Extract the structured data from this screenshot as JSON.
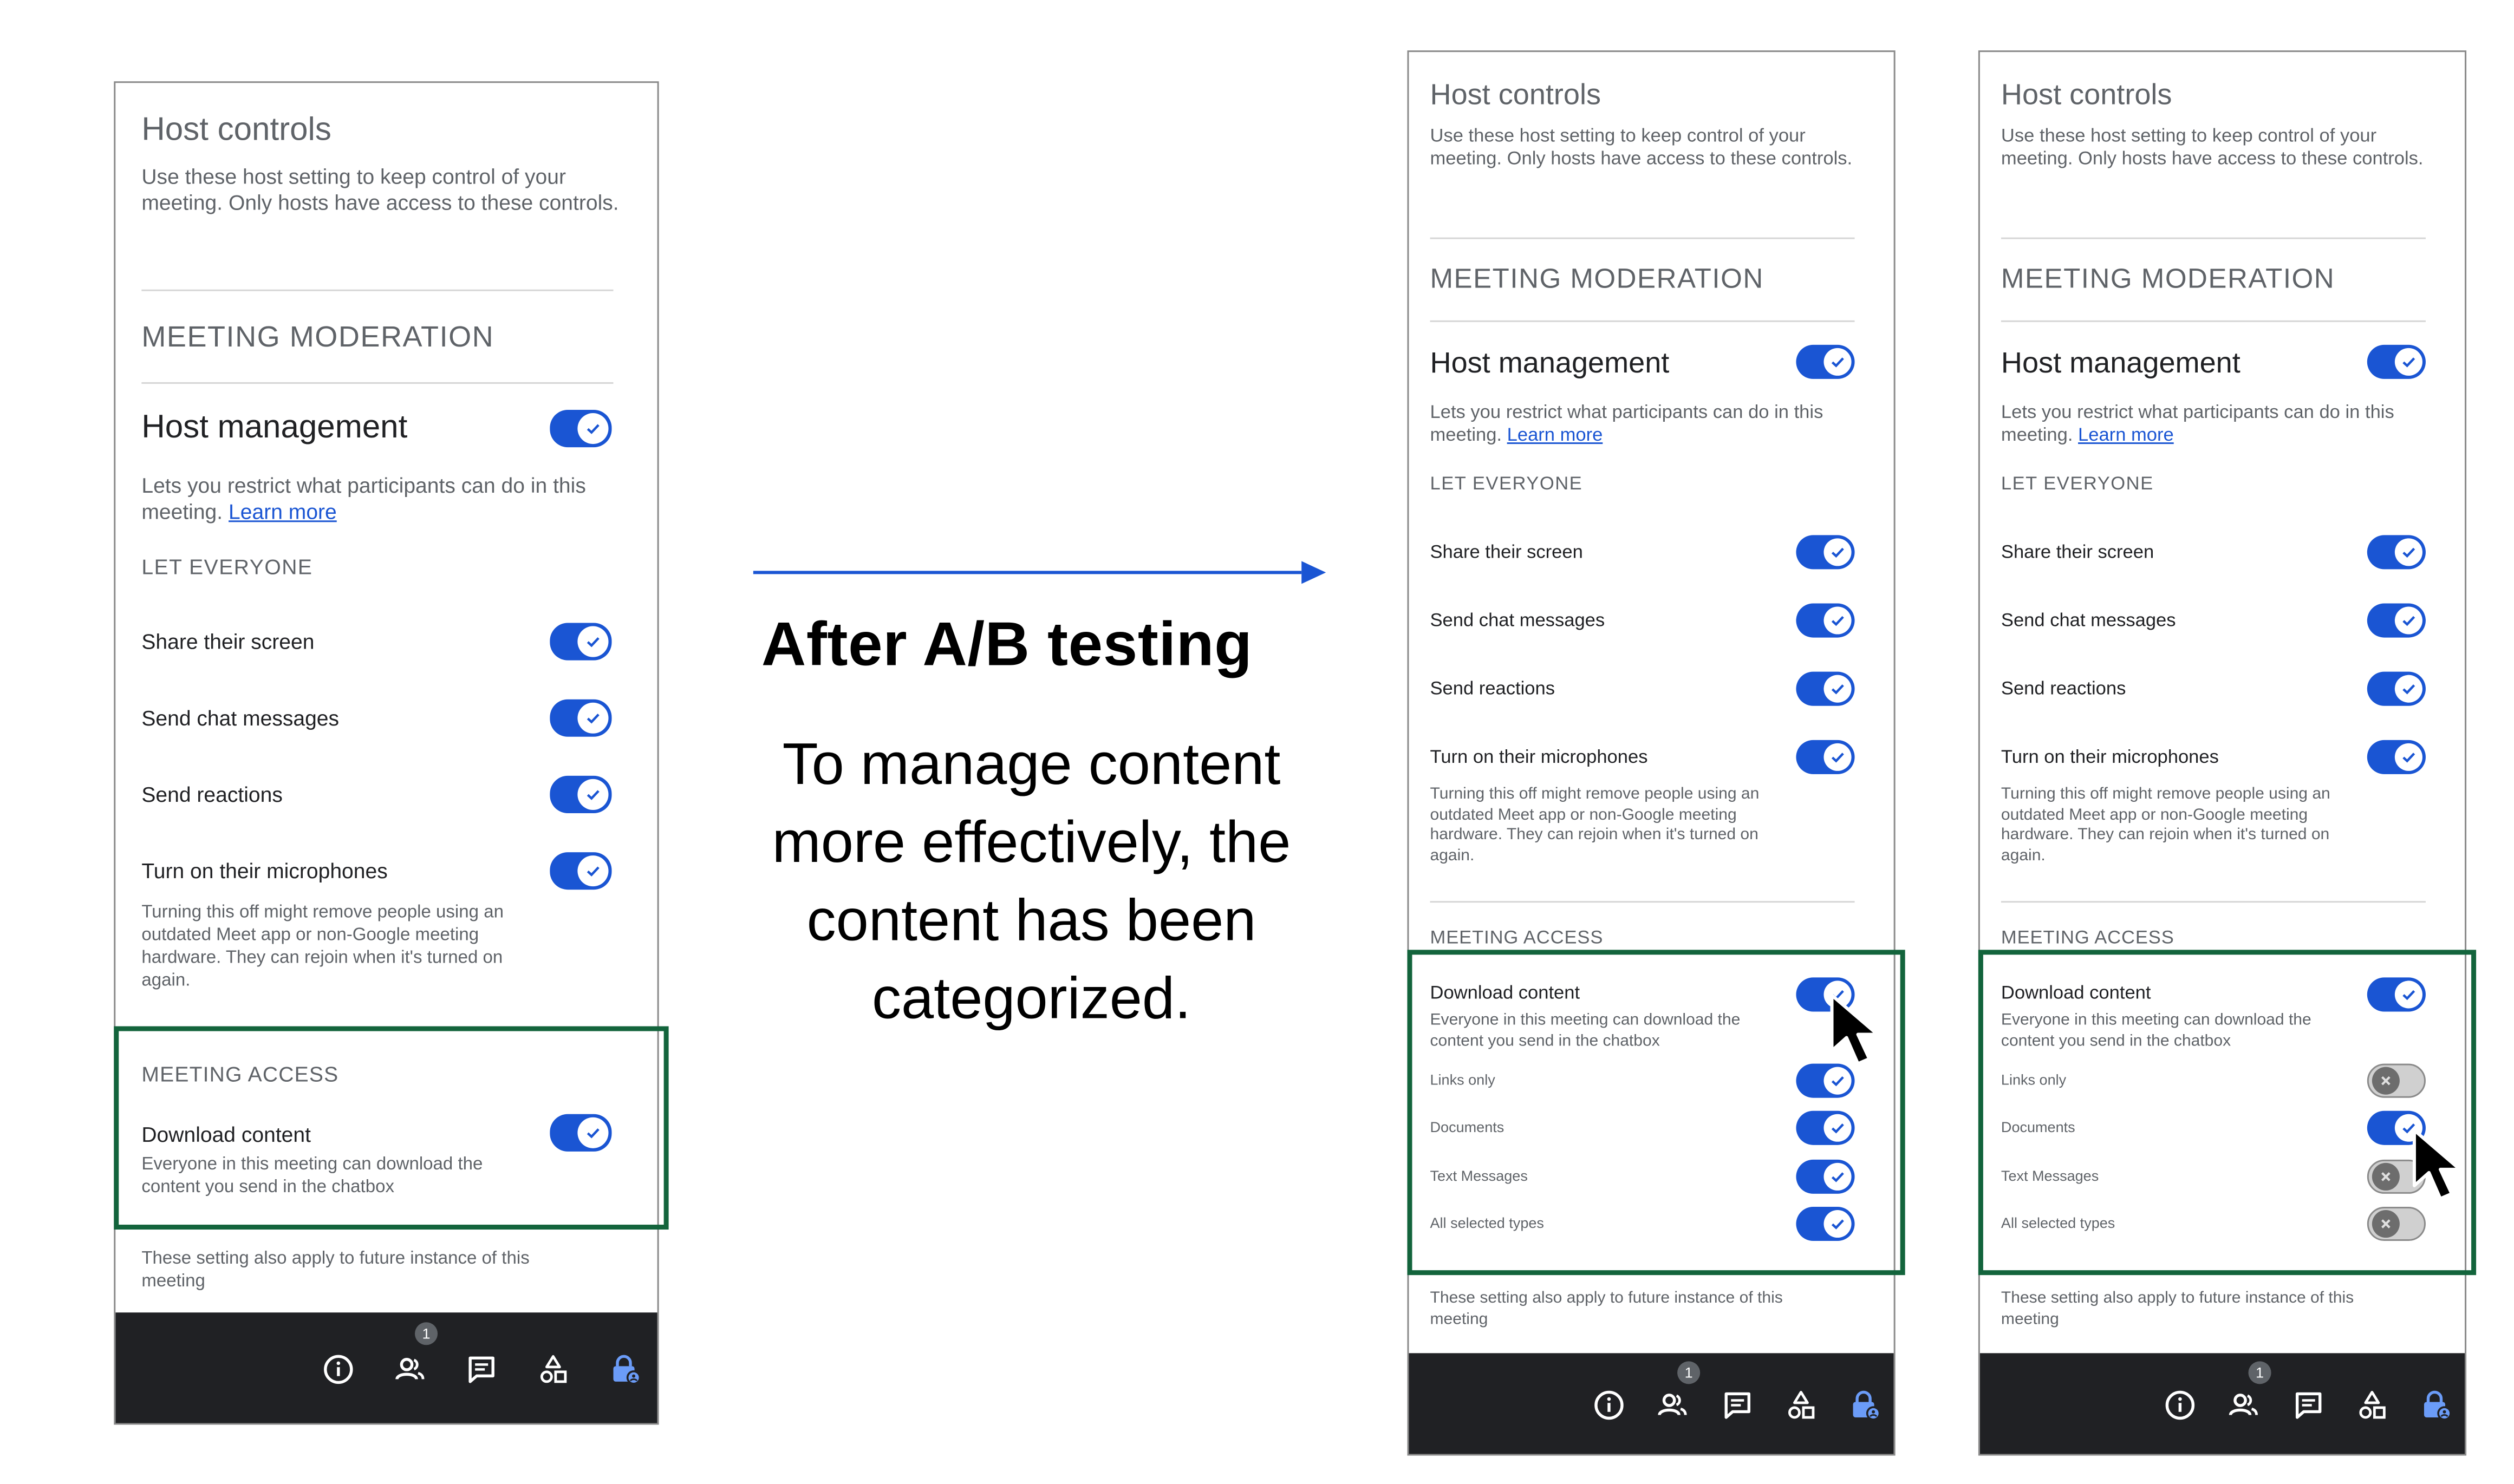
{
  "annotation": {
    "title": "After A/B testing",
    "description": "To manage content\nmore effectively, the\ncontent has been\ncategorized."
  },
  "colors": {
    "toggle_on": "#1a55d3",
    "toggle_off": "#d0d0d0",
    "highlight_border": "#13643c",
    "bottom_bar": "#202124",
    "arrow": "#1a55d3"
  },
  "panel_common": {
    "title": "Host controls",
    "intro": "Use these host setting to keep control of your meeting. Only hosts have access to these controls.",
    "moderation_heading": "MEETING MODERATION",
    "host_management": "Host management",
    "host_management_desc": "Lets you restrict what participants can do in this meeting.",
    "learn_more": "Learn more",
    "let_everyone": "LET EVERYONE",
    "share_screen": "Share their screen",
    "send_chat": "Send chat messages",
    "send_reactions": "Send reactions",
    "microphones": "Turn on their microphones",
    "microphones_note": "Turning this off might remove people using an outdated Meet app or non-Google meeting hardware. They can rejoin when it's turned on again.",
    "access_heading": "MEETING ACCESS",
    "download_content": "Download  content",
    "download_desc": "Everyone in this meeting can download the content you send in the chatbox",
    "future_note": "These setting also apply to future instance of this meeting",
    "participants_badge": "1",
    "bottom_icons": [
      "info-icon",
      "people-icon",
      "chat-icon",
      "activities-icon",
      "host-lock-icon"
    ]
  },
  "panels": [
    {
      "id": "before",
      "toggles": {
        "host_management": true,
        "share_screen": true,
        "send_chat": true,
        "send_reactions": true,
        "microphones": true,
        "download_content": true
      }
    },
    {
      "id": "after-all-on",
      "toggles": {
        "host_management": true,
        "share_screen": true,
        "send_chat": true,
        "send_reactions": true,
        "microphones": true,
        "download_content": true
      },
      "content_types": [
        {
          "label": "Links only",
          "on": true
        },
        {
          "label": "Documents",
          "on": true
        },
        {
          "label": "Text Messages",
          "on": true
        },
        {
          "label": "All selected types",
          "on": true
        }
      ]
    },
    {
      "id": "after-documents-only",
      "toggles": {
        "host_management": true,
        "share_screen": true,
        "send_chat": true,
        "send_reactions": true,
        "microphones": true,
        "download_content": true
      },
      "content_types": [
        {
          "label": "Links only",
          "on": false
        },
        {
          "label": "Documents",
          "on": true
        },
        {
          "label": "Text Messages",
          "on": false
        },
        {
          "label": "All selected types",
          "on": false
        }
      ]
    }
  ]
}
